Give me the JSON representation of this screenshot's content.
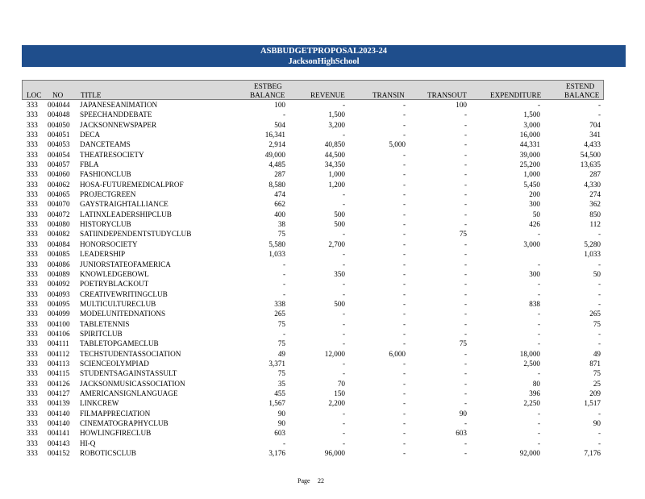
{
  "banner": {
    "title": "ASBBUDGETPROPOSAL2023-24",
    "school": "JacksonHighSchool"
  },
  "headers": {
    "loc": "LOC",
    "no": "NO",
    "title": "TITLE",
    "beg_top": "ESTBEG",
    "beg": "BALANCE",
    "revenue": "REVENUE",
    "trans_in": "TRANSIN",
    "trans_out": "TRANSOUT",
    "expenditure": "EXPENDITURE",
    "end_top": "ESTEND",
    "end": "BALANCE"
  },
  "rows": [
    {
      "loc": "333",
      "no": "004044",
      "title": "JAPANESEANIMATION",
      "beg": "100",
      "rev": "-",
      "tin": "-",
      "tout": "100",
      "exp": "-",
      "end": "-"
    },
    {
      "loc": "333",
      "no": "004048",
      "title": "SPEECHANDDEBATE",
      "beg": "-",
      "rev": "1,500",
      "tin": "-",
      "tout": "-",
      "exp": "1,500",
      "end": "-"
    },
    {
      "loc": "333",
      "no": "004050",
      "title": "JACKSONNEWSPAPER",
      "beg": "504",
      "rev": "3,200",
      "tin": "-",
      "tout": "-",
      "exp": "3,000",
      "end": "704"
    },
    {
      "loc": "333",
      "no": "004051",
      "title": "DECA",
      "beg": "16,341",
      "rev": "-",
      "tin": "-",
      "tout": "-",
      "exp": "16,000",
      "end": "341"
    },
    {
      "loc": "333",
      "no": "004053",
      "title": "DANCETEAMS",
      "beg": "2,914",
      "rev": "40,850",
      "tin": "5,000",
      "tout": "-",
      "exp": "44,331",
      "end": "4,433"
    },
    {
      "loc": "333",
      "no": "004054",
      "title": "THEATRESOCIETY",
      "beg": "49,000",
      "rev": "44,500",
      "tin": "-",
      "tout": "-",
      "exp": "39,000",
      "end": "54,500"
    },
    {
      "loc": "333",
      "no": "004057",
      "title": "FBLA",
      "beg": "4,485",
      "rev": "34,350",
      "tin": "-",
      "tout": "-",
      "exp": "25,200",
      "end": "13,635"
    },
    {
      "loc": "333",
      "no": "004060",
      "title": "FASHIONCLUB",
      "beg": "287",
      "rev": "1,000",
      "tin": "-",
      "tout": "-",
      "exp": "1,000",
      "end": "287"
    },
    {
      "loc": "333",
      "no": "004062",
      "title": "HOSA-FUTUREMEDICALPROF",
      "beg": "8,580",
      "rev": "1,200",
      "tin": "-",
      "tout": "-",
      "exp": "5,450",
      "end": "4,330"
    },
    {
      "loc": "333",
      "no": "004065",
      "title": "PROJECTGREEN",
      "beg": "474",
      "rev": "-",
      "tin": "-",
      "tout": "-",
      "exp": "200",
      "end": "274"
    },
    {
      "loc": "333",
      "no": "004070",
      "title": "GAYSTRAIGHTALLIANCE",
      "beg": "662",
      "rev": "-",
      "tin": "-",
      "tout": "-",
      "exp": "300",
      "end": "362"
    },
    {
      "loc": "333",
      "no": "004072",
      "title": "LATINXLEADERSHIPCLUB",
      "beg": "400",
      "rev": "500",
      "tin": "-",
      "tout": "-",
      "exp": "50",
      "end": "850"
    },
    {
      "loc": "333",
      "no": "004080",
      "title": "HISTORYCLUB",
      "beg": "38",
      "rev": "500",
      "tin": "-",
      "tout": "-",
      "exp": "426",
      "end": "112"
    },
    {
      "loc": "333",
      "no": "004082",
      "title": "SATIINDEPENDENTSTUDYCLUB",
      "beg": "75",
      "rev": "-",
      "tin": "-",
      "tout": "75",
      "exp": "-",
      "end": "-"
    },
    {
      "loc": "333",
      "no": "004084",
      "title": "HONORSOCIETY",
      "beg": "5,580",
      "rev": "2,700",
      "tin": "-",
      "tout": "-",
      "exp": "3,000",
      "end": "5,280"
    },
    {
      "loc": "333",
      "no": "004085",
      "title": "LEADERSHIP",
      "beg": "1,033",
      "rev": "-",
      "tin": "-",
      "tout": "-",
      "exp": "",
      "end": "1,033"
    },
    {
      "loc": "333",
      "no": "004086",
      "title": "JUNIORSTATEOFAMERICA",
      "beg": "-",
      "rev": "-",
      "tin": "-",
      "tout": "-",
      "exp": "-",
      "end": "-"
    },
    {
      "loc": "333",
      "no": "004089",
      "title": "KNOWLEDGEBOWL",
      "beg": "-",
      "rev": "350",
      "tin": "-",
      "tout": "-",
      "exp": "300",
      "end": "50"
    },
    {
      "loc": "333",
      "no": "004092",
      "title": "POETRYBLACKOUT",
      "beg": "-",
      "rev": "-",
      "tin": "-",
      "tout": "-",
      "exp": "-",
      "end": "-"
    },
    {
      "loc": "333",
      "no": "004093",
      "title": "CREATIVEWRITINGCLUB",
      "beg": "-",
      "rev": "-",
      "tin": "-",
      "tout": "-",
      "exp": "-",
      "end": "-"
    },
    {
      "loc": "333",
      "no": "004095",
      "title": "MULTICULTURECLUB",
      "beg": "338",
      "rev": "500",
      "tin": "-",
      "tout": "-",
      "exp": "838",
      "end": "-"
    },
    {
      "loc": "333",
      "no": "004099",
      "title": "MODELUNITEDNATIONS",
      "beg": "265",
      "rev": "-",
      "tin": "-",
      "tout": "-",
      "exp": "-",
      "end": "265"
    },
    {
      "loc": "333",
      "no": "004100",
      "title": "TABLETENNIS",
      "beg": "75",
      "rev": "-",
      "tin": "-",
      "tout": "-",
      "exp": "-",
      "end": "75"
    },
    {
      "loc": "333",
      "no": "004106",
      "title": "SPIRITCLUB",
      "beg": "-",
      "rev": "-",
      "tin": "-",
      "tout": "-",
      "exp": "-",
      "end": "-"
    },
    {
      "loc": "333",
      "no": "004111",
      "title": "TABLETOPGAMECLUB",
      "beg": "75",
      "rev": "-",
      "tin": "-",
      "tout": "75",
      "exp": "-",
      "end": "-"
    },
    {
      "loc": "333",
      "no": "004112",
      "title": "TECHSTUDENTASSOCIATION",
      "beg": "49",
      "rev": "12,000",
      "tin": "6,000",
      "tout": "-",
      "exp": "18,000",
      "end": "49"
    },
    {
      "loc": "333",
      "no": "004113",
      "title": "SCIENCEOLYMPIAD",
      "beg": "3,371",
      "rev": "-",
      "tin": "-",
      "tout": "-",
      "exp": "2,500",
      "end": "871"
    },
    {
      "loc": "333",
      "no": "004115",
      "title": "STUDENTSAGAINSTASSULT",
      "beg": "75",
      "rev": "-",
      "tin": "-",
      "tout": "-",
      "exp": "-",
      "end": "75"
    },
    {
      "loc": "333",
      "no": "004126",
      "title": "JACKSONMUSICASSOCIATION",
      "beg": "35",
      "rev": "70",
      "tin": "-",
      "tout": "-",
      "exp": "80",
      "end": "25"
    },
    {
      "loc": "333",
      "no": "004127",
      "title": "AMERICANSIGNLANGUAGE",
      "beg": "455",
      "rev": "150",
      "tin": "-",
      "tout": "-",
      "exp": "396",
      "end": "209"
    },
    {
      "loc": "333",
      "no": "004139",
      "title": "LINKCREW",
      "beg": "1,567",
      "rev": "2,200",
      "tin": "-",
      "tout": "-",
      "exp": "2,250",
      "end": "1,517"
    },
    {
      "loc": "333",
      "no": "004140",
      "title": "FILMAPPRECIATION",
      "beg": "90",
      "rev": "-",
      "tin": "-",
      "tout": "90",
      "exp": "-",
      "end": "-"
    },
    {
      "loc": "333",
      "no": "004140",
      "title": "CINEMATOGRAPHYCLUB",
      "beg": "90",
      "rev": "-",
      "tin": "-",
      "tout": "-",
      "exp": "-",
      "end": "90"
    },
    {
      "loc": "333",
      "no": "004141",
      "title": "HOWLINGFIRECLUB",
      "beg": "603",
      "rev": "-",
      "tin": "-",
      "tout": "603",
      "exp": "-",
      "end": "-"
    },
    {
      "loc": "333",
      "no": "004143",
      "title": "HI-Q",
      "beg": "-",
      "rev": "-",
      "tin": "-",
      "tout": "-",
      "exp": "-",
      "end": "-"
    },
    {
      "loc": "333",
      "no": "004152",
      "title": "ROBOTICSCLUB",
      "beg": "3,176",
      "rev": "96,000",
      "tin": "-",
      "tout": "-",
      "exp": "92,000",
      "end": "7,176"
    }
  ],
  "footer": {
    "page_label": "Page",
    "page_number": "22"
  }
}
